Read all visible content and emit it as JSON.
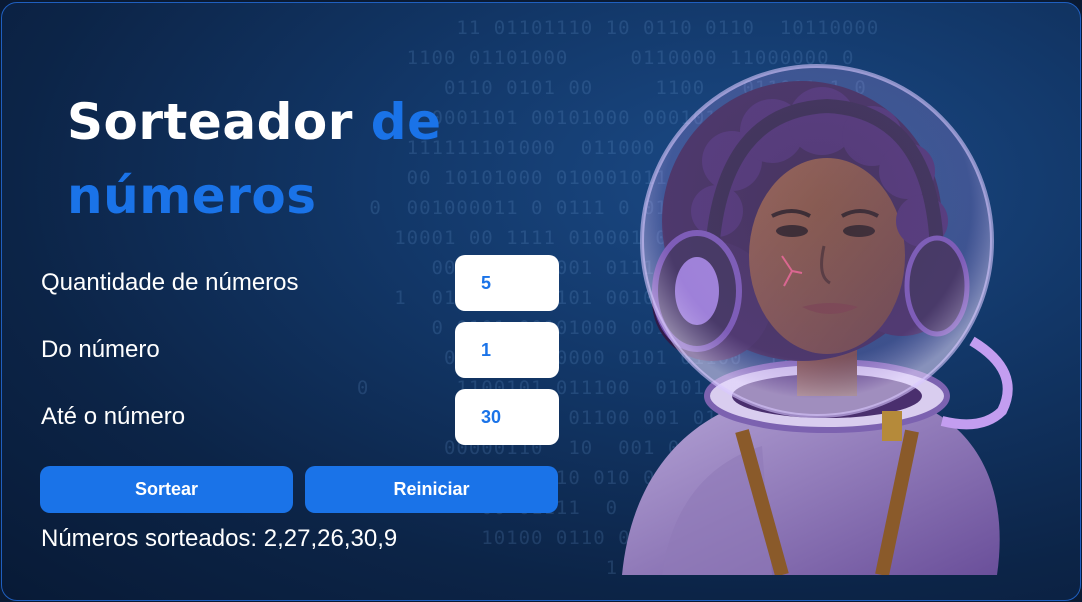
{
  "title": {
    "main": "Sorteador",
    "accent_1": "de",
    "accent_2": "números"
  },
  "form": {
    "quantity": {
      "label": "Quantidade de números",
      "value": "5"
    },
    "from": {
      "label": "Do número",
      "value": "1"
    },
    "to": {
      "label": "Até o número",
      "value": "30"
    }
  },
  "buttons": {
    "draw_label": "Sortear",
    "reset_label": "Reiniciar"
  },
  "result": {
    "text": "Números sorteados: 2,27,26,30,9"
  },
  "colors": {
    "accent": "#1a73e8",
    "background": "#0c2447",
    "text": "#ffffff"
  },
  "illustration": {
    "icon": "astronaut-girl-illustration"
  }
}
